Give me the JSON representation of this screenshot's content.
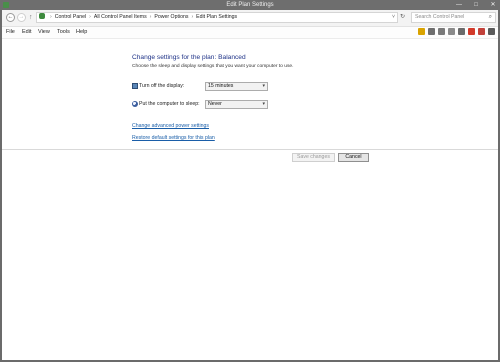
{
  "window": {
    "title": "Edit Plan Settings",
    "controls": [
      "—",
      "□",
      "✕"
    ]
  },
  "addressbar": {
    "nav_back": "←",
    "nav_forward": "→",
    "nav_up": "↑",
    "crumbs": [
      "Control Panel",
      "All Control Panel Items",
      "Power Options",
      "Edit Plan Settings"
    ],
    "dropdown_glyph": "˅",
    "refresh": "↻",
    "search_placeholder": "Search Control Panel",
    "search_icon": "⌕"
  },
  "menubar": {
    "items": [
      "File",
      "Edit",
      "View",
      "Tools",
      "Help"
    ],
    "toolbar_icons": [
      {
        "name": "lock-icon",
        "color": "#d9a300"
      },
      {
        "name": "cut-icon",
        "color": "#6e6e6e"
      },
      {
        "name": "copy-icon",
        "color": "#7a7a7a"
      },
      {
        "name": "paste-icon",
        "color": "#8a8a8a"
      },
      {
        "name": "undo-icon",
        "color": "#6b6b6b"
      },
      {
        "name": "delete-icon",
        "color": "#d23a2a"
      },
      {
        "name": "properties-icon",
        "color": "#c2413a"
      },
      {
        "name": "settings-icon",
        "color": "#5a5a5a"
      }
    ]
  },
  "main": {
    "heading": "Change settings for the plan: Balanced",
    "subtext": "Choose the sleep and display settings that you want your computer to use.",
    "display": {
      "label": "Turn off the display:",
      "value": "15 minutes"
    },
    "sleep": {
      "label": "Put the computer to sleep:",
      "value": "Never"
    },
    "link_advanced": "Change advanced power settings",
    "link_restore": "Restore default settings for this plan",
    "save_button": "Save changes",
    "cancel_button": "Cancel"
  },
  "colors": {
    "heading": "#1e3287",
    "link": "#1a5ea8"
  }
}
